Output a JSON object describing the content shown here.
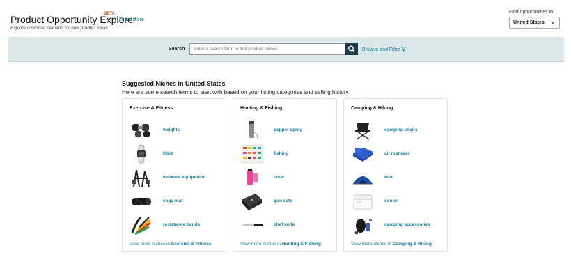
{
  "header": {
    "title": "Product Opportunity Explorer",
    "beta": "BETA",
    "learn_more": "Learn More",
    "subtitle": "Explore customer demand for new product ideas"
  },
  "country": {
    "label": "Find opportunities in:",
    "selected": "United States"
  },
  "search": {
    "label": "Search",
    "placeholder": "Enter a search term to find product niches",
    "button_icon": "search-icon",
    "browse_filter": "Browse and Filter"
  },
  "suggested": {
    "title": "Suggested Niches in United States",
    "subtitle": "Here are some search terms to start with based on your listing categories and selling history.",
    "view_more_prefix": "View more niches in ",
    "categories": [
      {
        "name": "Exercise & Fitness",
        "niches": [
          {
            "label": "weights",
            "icon": "dumbbells-icon"
          },
          {
            "label": "fitbit",
            "icon": "fitness-tracker-icon"
          },
          {
            "label": "workout equipment",
            "icon": "home-gym-icon"
          },
          {
            "label": "yoga mat",
            "icon": "yoga-mat-icon"
          },
          {
            "label": "resistance bands",
            "icon": "resistance-bands-icon"
          }
        ]
      },
      {
        "name": "Hunting & Fishing",
        "niches": [
          {
            "label": "pepper spray",
            "icon": "pepper-spray-icon"
          },
          {
            "label": "fishing",
            "icon": "fishing-lures-icon"
          },
          {
            "label": "taser",
            "icon": "taser-icon"
          },
          {
            "label": "gun safe",
            "icon": "gun-safe-icon"
          },
          {
            "label": "chef knife",
            "icon": "knife-icon"
          }
        ]
      },
      {
        "name": "Camping & Hiking",
        "niches": [
          {
            "label": "camping chairs",
            "icon": "camping-chair-icon"
          },
          {
            "label": "air mattress",
            "icon": "air-mattress-icon"
          },
          {
            "label": "tent",
            "icon": "tent-icon"
          },
          {
            "label": "cooler",
            "icon": "cooler-icon"
          },
          {
            "label": "camping accessories",
            "icon": "camping-gear-icon"
          }
        ]
      }
    ]
  },
  "colors": {
    "link": "#0f7d9c",
    "search_bar": "#dbe8ea",
    "search_button": "#1d3a4a",
    "beta": "#c7511f"
  }
}
